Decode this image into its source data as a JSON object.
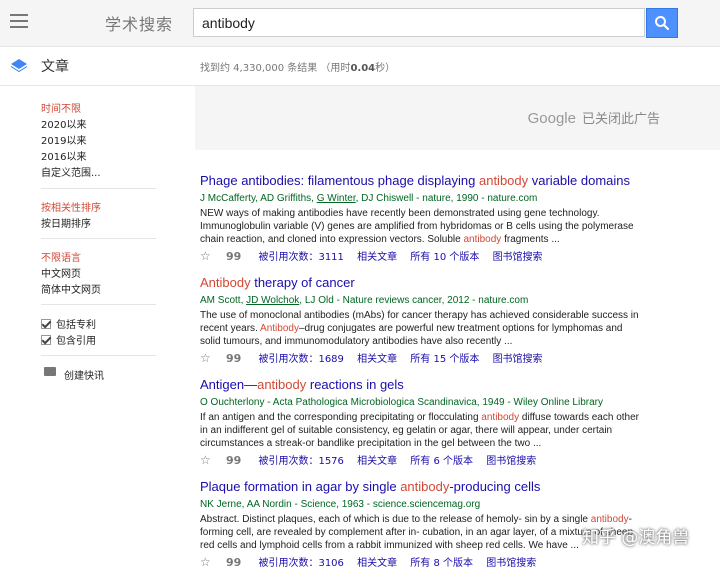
{
  "header": {
    "brand": "学术搜索",
    "search_value": "antibody"
  },
  "subheader": {
    "section": "文章",
    "stats_prefix": "找到约 4,330,000 条结果 （用时",
    "stats_time": "0.04",
    "stats_suffix": "秒）"
  },
  "sidebar": {
    "time": [
      "时间不限",
      "2020以来",
      "2019以来",
      "2016以来",
      "自定义范围..."
    ],
    "sort": [
      "按相关性排序",
      "按日期排序"
    ],
    "language": [
      "不限语言",
      "中文网页",
      "简体中文网页"
    ],
    "include": [
      "包括专利",
      "包含引用"
    ],
    "alert": "创建快讯"
  },
  "ad": {
    "google": "Google",
    "text": "已关闭此广告"
  },
  "results": [
    {
      "title_pre": "Phage antibodies: filamentous phage displaying ",
      "title_hl": "antibody",
      "title_post": " variable domains",
      "meta_pre": "J McCafferty, AD Griffiths, ",
      "meta_link": "G Winter",
      "meta_post": ", DJ Chiswell - nature, 1990 - nature.com",
      "snippet_pre": "NEW ways of making antibodies have recently been demonstrated using gene technology. Immunoglobulin variable (V) genes are amplified from hybridomas or B cells using the polymerase chain reaction, and cloned into expression vectors. Soluble ",
      "snippet_hl": "antibody",
      "snippet_post": " fragments ...",
      "cited": "被引用次数：3111",
      "related": "相关文章",
      "versions": "所有 10 个版本",
      "library": "图书馆搜索"
    },
    {
      "title_pre": "",
      "title_hl": "Antibody",
      "title_post": " therapy of cancer",
      "meta_pre": "AM Scott, ",
      "meta_link": "JD Wolchok",
      "meta_post": ", LJ Old - Nature reviews cancer, 2012 - nature.com",
      "snippet_pre": "The use of monoclonal antibodies (mAbs) for cancer therapy has achieved considerable success in recent years. ",
      "snippet_hl": "Antibody",
      "snippet_post": "–drug conjugates are powerful new treatment options for lymphomas and solid tumours, and immunomodulatory antibodies have also recently ...",
      "cited": "被引用次数：1689",
      "related": "相关文章",
      "versions": "所有 15 个版本",
      "library": "图书馆搜索"
    },
    {
      "title_pre": "Antigen—",
      "title_hl": "antibody",
      "title_post": " reactions in gels",
      "meta_pre": "O Ouchterlony - Acta Pathologica Microbiologica Scandinavica, 1949 - Wiley Online Library",
      "meta_link": "",
      "meta_post": "",
      "snippet_pre": "If an antigen and the corresponding precipitating or flocculating ",
      "snippet_hl": "antibody",
      "snippet_post": " diffuse towards each other in an indifferent gel of suitable consistency, eg gelatin or agar, there will appear, under certain circumstances a streak-or bandlike precipitation in the gel between the two ...",
      "cited": "被引用次数：1576",
      "related": "相关文章",
      "versions": "所有 6 个版本",
      "library": "图书馆搜索"
    },
    {
      "title_pre": "Plaque formation in agar by single ",
      "title_hl": "antibody",
      "title_post": "-producing cells",
      "meta_pre": "NK Jerne, AA Nordin - Science, 1963 - science.sciencemag.org",
      "meta_link": "",
      "meta_post": "",
      "snippet_pre": "Abstract. Distinct plaques, each of which is due to the release of hemoly- sin by a single ",
      "snippet_hl": "antibody",
      "snippet_post": "-forming cell, are revealed by complement after in- cubation, in an agar layer, of a mixture of sheep red cells and lymphoid cells from a rabbit immunized with sheep red cells. We have ...",
      "cited": "被引用次数：3106",
      "related": "相关文章",
      "versions": "所有 8 个版本",
      "library": "图书馆搜索"
    }
  ],
  "watermark": "知乎 @澳角兽"
}
